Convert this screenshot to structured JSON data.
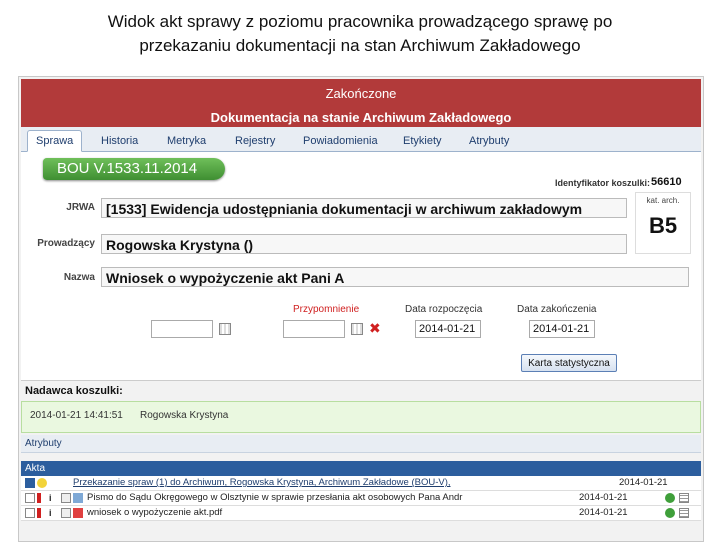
{
  "slide": {
    "title_line1": "Widok akt sprawy z poziomu pracownika prowadzącego sprawę po",
    "title_line2": "przekazaniu dokumentacji na stan Archiwum Zakładowego"
  },
  "status": {
    "label": "Zakończone",
    "doc_state": "Dokumentacja na stanie Archiwum Zakładowego"
  },
  "tabs": [
    "Sprawa",
    "Historia",
    "Metryka",
    "Rejestry",
    "Powiadomienia",
    "Etykiety",
    "Atrybuty"
  ],
  "case": {
    "number": "BOU V.1533.11.2014",
    "id_label": "Identyfikator koszulki:",
    "id_value": "56610",
    "jrwa_label": "JRWA",
    "jrwa_value": "[1533] Ewidencja udostępniania dokumentacji w archiwum zakładowym",
    "owner_label": "Prowadzący",
    "owner_value": "Rogowska Krystyna ()",
    "name_label": "Nazwa",
    "name_value": "Wniosek o wypożyczenie akt Pani A",
    "kat_label": "kat. arch.",
    "kat_value": "B5"
  },
  "dates": {
    "reminder_label": "Przypomnienie",
    "start_label": "Data rozpoczęcia",
    "start_value": "2014-01-21",
    "end_label": "Data zakończenia",
    "end_value": "2014-01-21"
  },
  "buttons": {
    "stats": "Karta statystyczna"
  },
  "sender": {
    "header": "Nadawca koszulki:",
    "datetime": "2014-01-21 14:41:51",
    "name": "Rogowska Krystyna"
  },
  "attributes_label": "Atrybuty",
  "akta": {
    "header": "Akta",
    "rows": [
      {
        "text": "Przekazanie spraw (1) do Archiwum, Rogowska Krystyna, Archiwum Zakładowe (BOU-V),",
        "date": "2014-01-21"
      },
      {
        "text": "Pismo do Sądu Okręgowego w Olsztynie w sprawie przesłania akt osobowych Pana Andr",
        "date": "2014-01-21"
      },
      {
        "text": "wniosek o wypożyczenie akt.pdf",
        "date": "2014-01-21"
      }
    ]
  },
  "colors": {
    "status_red": "#b23a3a",
    "case_green": "#4f9f3e",
    "akta_blue": "#2c5e9e"
  }
}
